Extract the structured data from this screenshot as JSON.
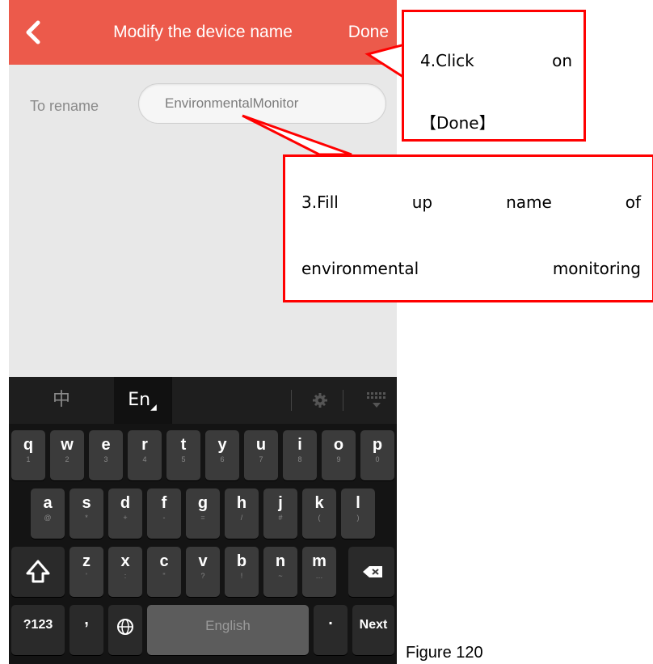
{
  "app": {
    "title": "Modify the device name",
    "done_label": "Done",
    "back_icon": "chevron-left-icon",
    "accent_color": "#ec5a4b"
  },
  "form": {
    "rename_label": "To rename",
    "rename_value": "EnvironmentalMonitor"
  },
  "keyboard": {
    "tabs": {
      "chinese": "中",
      "english": "En"
    },
    "settings_icon": "gear-icon",
    "hide_icon": "keyboard-hide-icon",
    "row1": [
      {
        "k": "q",
        "s": "1"
      },
      {
        "k": "w",
        "s": "2"
      },
      {
        "k": "e",
        "s": "3"
      },
      {
        "k": "r",
        "s": "4"
      },
      {
        "k": "t",
        "s": "5"
      },
      {
        "k": "y",
        "s": "6"
      },
      {
        "k": "u",
        "s": "7"
      },
      {
        "k": "i",
        "s": "8"
      },
      {
        "k": "o",
        "s": "9"
      },
      {
        "k": "p",
        "s": "0"
      }
    ],
    "row2": [
      {
        "k": "a",
        "s": "@"
      },
      {
        "k": "s",
        "s": "*"
      },
      {
        "k": "d",
        "s": "+"
      },
      {
        "k": "f",
        "s": "-"
      },
      {
        "k": "g",
        "s": "="
      },
      {
        "k": "h",
        "s": "/"
      },
      {
        "k": "j",
        "s": "#"
      },
      {
        "k": "k",
        "s": "("
      },
      {
        "k": "l",
        "s": ")"
      }
    ],
    "row3": [
      {
        "k": "z",
        "s": "'"
      },
      {
        "k": "x",
        "s": ":"
      },
      {
        "k": "c",
        "s": "\""
      },
      {
        "k": "v",
        "s": "?"
      },
      {
        "k": "b",
        "s": "!"
      },
      {
        "k": "n",
        "s": "~"
      },
      {
        "k": "m",
        "s": "…"
      }
    ],
    "symbols_label": "?123",
    "comma": ",",
    "space_label": "English",
    "period": ".",
    "next_label": "Next"
  },
  "annotations": {
    "step4": {
      "line1_a": "4.Click",
      "line1_b": "on",
      "line2": "【Done】"
    },
    "step3": {
      "w1": "3.Fill",
      "w2": "up",
      "w3": "name",
      "w4": "of",
      "w5": "environmental",
      "w6": "monitoring"
    },
    "color": "#ff0000"
  },
  "caption": "Figure 120"
}
